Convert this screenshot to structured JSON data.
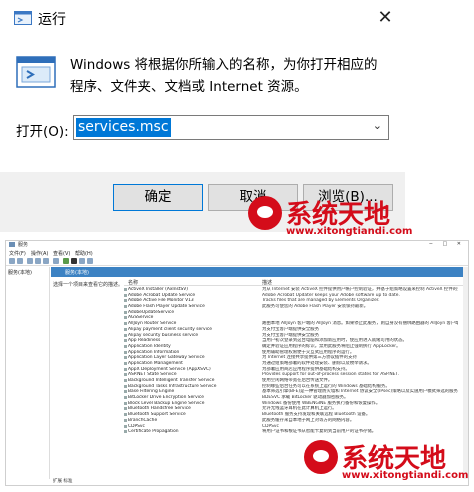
{
  "run": {
    "title": "运行",
    "desc": "Windows 将根据你所输入的名称，为你打开相应的程序、文件夹、文档或 Internet 资源。",
    "open_label": "打开(O):",
    "input_value": "services.msc",
    "ok": "确定",
    "cancel": "取消",
    "browse": "浏览(B)...",
    "close_glyph": "✕",
    "arrow_glyph": "⌄"
  },
  "watermark": {
    "title": "系统天地",
    "url": "www.xitongtiandi.com"
  },
  "services": {
    "title": "服务",
    "menu": [
      "文件(F)",
      "操作(A)",
      "查看(V)",
      "帮助(H)"
    ],
    "tree_item": "服务(本地)",
    "tab_label": "服务(本地)",
    "desc_pane": "选择一个项目来查看它的描述。",
    "col_name": "名称",
    "col_desc": "描述",
    "status": "扩展  标准",
    "rows": [
      {
        "name": "ActiveX Installer (AxInstSV)",
        "desc": "为从 Internet 安装 ActiveX 控件提供用户帐户控制验证，并基于组策略设置来控制 ActiveX 控件的安装。"
      },
      {
        "name": "Adobe Acrobat Update Service",
        "desc": "Adobe Acrobat Updater keeps your Adobe software up to date."
      },
      {
        "name": "Adobe Active File Monitor V13",
        "desc": "Tracks files that are managed by Elements Organizer."
      },
      {
        "name": "Adobe Flash Player Update Service",
        "desc": "此服务可使您的 Adobe Flash Player 安装保持最新。"
      },
      {
        "name": "AdobeUpdateService",
        "desc": ""
      },
      {
        "name": "AGSService",
        "desc": ""
      },
      {
        "name": "AllJoyn Router Service",
        "desc": "路由本地 AllJoyn 客户端的 AllJoyn 消息。如果停止此服务，则自身没有捆绑路由器的 AllJoyn 客户端将无法运行。"
      },
      {
        "name": "Alipay payment client security service",
        "desc": "为支付宝客户端提供安全服务"
      },
      {
        "name": "Alipay security business service",
        "desc": "为支付宝客户端提供安全服务"
      },
      {
        "name": "App Readiness",
        "desc": "当用户初次登录到这台电脑和添加新应用时，使应用进入就绪可用的状态。"
      },
      {
        "name": "Application Identity",
        "desc": "确定并验证应用程序的标识。禁用此服务将阻止强制执行 AppLocker。"
      },
      {
        "name": "Application Information",
        "desc": "使用辅助管理权限便于交互式应用程序的运行。"
      },
      {
        "name": "Application Layer Gateway Service",
        "desc": "为 Internet 连接共享提供第三方协议插件的支持"
      },
      {
        "name": "Application Management",
        "desc": "为通过组策略部署的软件处理安装、删除以及枚举请求。"
      },
      {
        "name": "AppX Deployment Service (AppXSVC)",
        "desc": "为部署应用商店应用程序提供基础结构支持。"
      },
      {
        "name": "ASP.NET State Service",
        "desc": "Provides support for out-of-process session states for ASP.NET."
      },
      {
        "name": "Background Intelligent Transfer Service",
        "desc": "使用空闲网络带宽在后台传送文件。"
      },
      {
        "name": "Background Tasks Infrastructure Service",
        "desc": "控制哪些后台任务可以在系统上运行的 Windows 基础结构服务。"
      },
      {
        "name": "Base Filtering Engine",
        "desc": "基本筛选引擎(BFE)是一种管理防火墙和 Internet 协议安全(IPsec)策略以及实施用户模式筛选的服务。"
      },
      {
        "name": "BitLocker Drive Encryption Service",
        "desc": "BDESVC 承载 BitLocker 驱动器加密服务。"
      },
      {
        "name": "Block Level Backup Engine Service",
        "desc": "Windows 备份使用 WBENGINE 服务执行备份和恢复操作。"
      },
      {
        "name": "Bluetooth Handsfree Service",
        "desc": "允许无线蓝牙耳机在此计算机上运行。"
      },
      {
        "name": "Bluetooth Support Service",
        "desc": "Bluetooth 服务支持发现和关联远程 Bluetooth 设备。"
      },
      {
        "name": "BranchCache",
        "desc": "此服务缓存来自本地子网上对等方的网络内容。"
      },
      {
        "name": "CDPSvc",
        "desc": "CDPSvc"
      },
      {
        "name": "Certificate Propagation",
        "desc": "将用户证书和根证书从智能卡复制到当前用户的证书存储。"
      }
    ]
  }
}
